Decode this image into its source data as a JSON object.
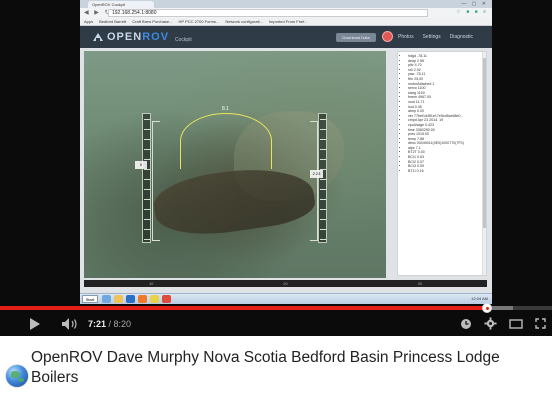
{
  "browser": {
    "tab_title": "OpenROV Cockpit",
    "window_controls": "— ▢ ✕",
    "url": "192.168.254.1:8080",
    "bookmarks": [
      "Apps",
      "Bedford Barrett",
      "Craft Brew Purchase...",
      "HP PCC 2700 Forms...",
      "Network configurati...",
      "Imported From Firef..."
    ]
  },
  "app": {
    "logo_prefix": "OPEN",
    "logo_rov": "ROV",
    "logo_subtitle": "Cockpit",
    "full_telemetry_button": "Download Data",
    "nav": [
      "Photos",
      "Settings",
      "Diagnostic"
    ]
  },
  "hud": {
    "heading": "8.1",
    "depth": "0",
    "throttle": "2.23"
  },
  "telemetry": [
    "hdgd -78.11",
    "deap 2.56",
    "pitc 4.70",
    "roll 2.92",
    "yaw -78.11",
    "fthr 25.00",
    "motorAttached 1",
    "servo 1100",
    "starg 1100",
    "fmem 4967.00",
    "vout 11.71",
    "iout 0.45",
    "atmp 0.00",
    "ver 77bef1d4ff1e17e5cd5ce68e0 -",
    "cmpd Apr 23 2014, 19",
    "cpuUsage 0.423",
    "time 3360290.00",
    "pres 1015.00",
    "temp 7.88",
    "dtmc 00049011(0E0)1000770(7F0)",
    "alps 7.1",
    "BT2T 0.00",
    "BCI1 0.63",
    "BCI2 0.07",
    "BCI3 0.09",
    "BT1I 0.16"
  ],
  "status_labels": [
    "10",
    "20",
    "30"
  ],
  "taskbar": {
    "start_label": "Start",
    "tray_text": "12:04 AM"
  },
  "player": {
    "current_time": "7:21",
    "separator": " / ",
    "total_time": "8:20",
    "played_fraction": 0.882,
    "loaded_fraction": 0.93,
    "accent_color": "#e52117"
  },
  "video": {
    "title": "OpenROV Dave Murphy Nova Scotia Bedford Basin Princess Lodge Boilers"
  }
}
